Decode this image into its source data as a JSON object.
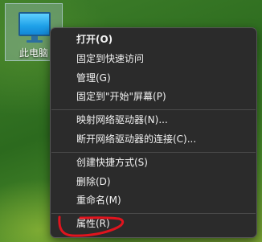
{
  "desktop": {
    "icon_name": "computer-icon",
    "icon_label": "此电脑"
  },
  "context_menu": {
    "items": [
      {
        "label": "打开(O)"
      },
      {
        "label": "固定到快速访问"
      },
      {
        "label": "管理(G)"
      },
      {
        "label": "固定到\"开始\"屏幕(P)"
      },
      {
        "label": "映射网络驱动器(N)..."
      },
      {
        "label": "断开网络驱动器的连接(C)..."
      },
      {
        "label": "创建快捷方式(S)"
      },
      {
        "label": "删除(D)"
      },
      {
        "label": "重命名(M)"
      },
      {
        "label": "属性(R)"
      }
    ],
    "colors": {
      "background": "#2b2b2b",
      "text": "#f2f2f2",
      "separator": "#4a4a4a",
      "annotation": "#e0141e"
    }
  }
}
